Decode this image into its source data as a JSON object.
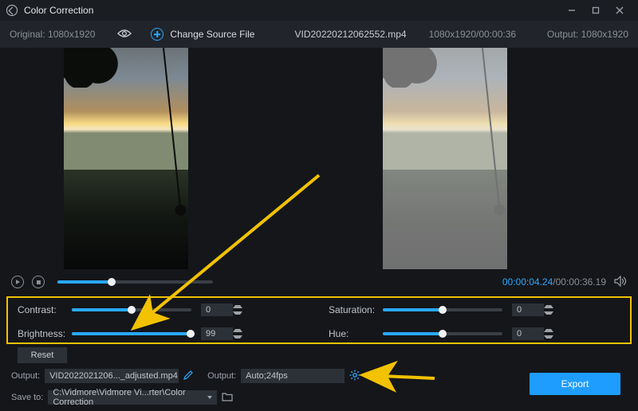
{
  "window": {
    "title": "Color Correction"
  },
  "header": {
    "original_label": "Original: 1080x1920",
    "change_source": "Change Source File",
    "filename": "VID20220212062552.mp4",
    "dims_time": "1080x1920/00:00:36",
    "output_label": "Output: 1080x1920"
  },
  "playback": {
    "seek_pct": 35,
    "current": "00:00:04.24",
    "total": "/00:00:36.19"
  },
  "controls": {
    "contrast": {
      "label": "Contrast:",
      "value": "0",
      "pct": 50
    },
    "brightness": {
      "label": "Brightness:",
      "value": "99",
      "pct": 99
    },
    "saturation": {
      "label": "Saturation:",
      "value": "0",
      "pct": 50
    },
    "hue": {
      "label": "Hue:",
      "value": "0",
      "pct": 50
    },
    "reset": "Reset"
  },
  "footer": {
    "out_file_label": "Output:",
    "out_file": "VID2022021206..._adjusted.mp4",
    "out_fmt_label": "Output:",
    "out_fmt": "Auto;24fps",
    "save_label": "Save to:",
    "save_path": "C:\\Vidmore\\Vidmore Vi...rter\\Color Correction",
    "export": "Export"
  }
}
